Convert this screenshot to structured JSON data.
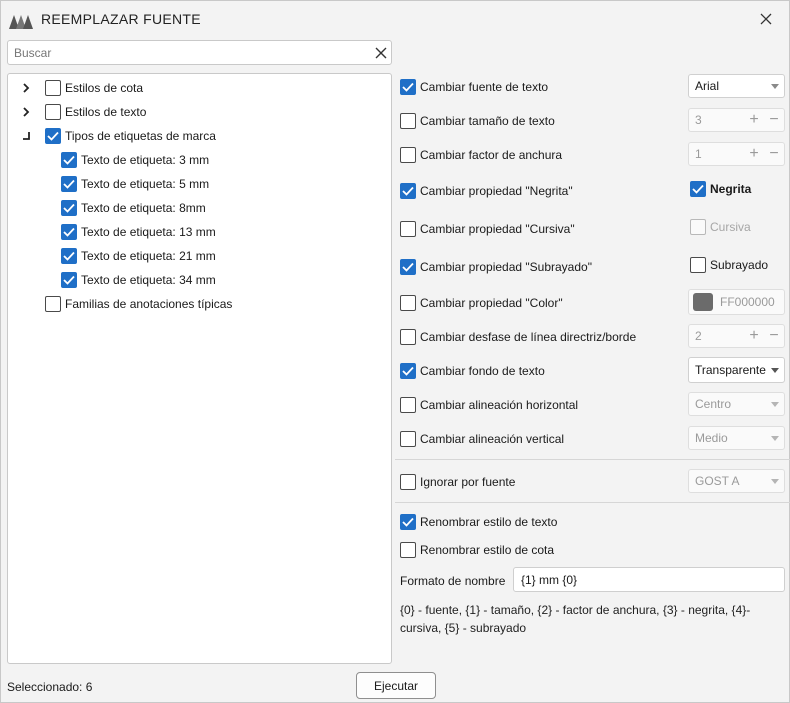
{
  "window": {
    "title": "REEMPLAZAR FUENTE",
    "logo_icon": "app-logo-icon",
    "close_icon": "close-icon"
  },
  "search": {
    "placeholder": "Buscar",
    "value": ""
  },
  "tree": [
    {
      "label": "Estilos de cota",
      "checked": false,
      "expander": "chevron-right",
      "level": 0
    },
    {
      "label": "Estilos de texto",
      "checked": false,
      "expander": "chevron-right",
      "level": 0
    },
    {
      "label": "Tipos de etiquetas de marca",
      "checked": true,
      "expander": "expanded",
      "level": 0
    },
    {
      "label": "Texto de etiqueta: 3 mm",
      "checked": true,
      "level": 1
    },
    {
      "label": "Texto de etiqueta: 5 mm",
      "checked": true,
      "level": 1
    },
    {
      "label": "Texto de etiqueta: 8mm",
      "checked": true,
      "level": 1
    },
    {
      "label": "Texto de etiqueta: 13 mm",
      "checked": true,
      "level": 1
    },
    {
      "label": "Texto de etiqueta: 21 mm",
      "checked": true,
      "level": 1
    },
    {
      "label": "Texto de etiqueta: 34 mm",
      "checked": true,
      "level": 1
    },
    {
      "label": "Familias de anotaciones típicas",
      "checked": false,
      "level": 0
    }
  ],
  "options": {
    "font": {
      "label": "Cambiar fuente de texto",
      "checked": true,
      "value": "Arial"
    },
    "size": {
      "label": "Cambiar tamaño de texto",
      "checked": false,
      "value": "3"
    },
    "width": {
      "label": "Cambiar factor de anchura",
      "checked": false,
      "value": "1"
    },
    "bold": {
      "label": "Cambiar propiedad \"Negrita\"",
      "checked": true,
      "side_label": "Negrita",
      "side_checked": true
    },
    "italic": {
      "label": "Cambiar propiedad \"Cursiva\"",
      "checked": false,
      "side_label": "Cursiva",
      "side_checked": false
    },
    "underline": {
      "label": "Cambiar propiedad \"Subrayado\"",
      "checked": true,
      "side_label": "Subrayado",
      "side_checked": false
    },
    "color": {
      "label": "Cambiar propiedad \"Color\"",
      "checked": false,
      "value": "FF000000",
      "swatch": "#6b6b6b"
    },
    "offset": {
      "label": "Cambiar desfase de línea directriz/borde",
      "checked": false,
      "value": "2"
    },
    "background": {
      "label": "Cambiar fondo de texto",
      "checked": true,
      "value": "Transparente"
    },
    "halign": {
      "label": "Cambiar alineación horizontal",
      "checked": false,
      "value": "Centro"
    },
    "valign": {
      "label": "Cambiar alineación vertical",
      "checked": false,
      "value": "Medio"
    },
    "ignore": {
      "label": "Ignorar por fuente",
      "checked": false,
      "value": "GOST A"
    },
    "rename_text": {
      "label": "Renombrar estilo de texto",
      "checked": true
    },
    "rename_dim": {
      "label": "Renombrar estilo de cota",
      "checked": false
    }
  },
  "name_format": {
    "label": "Formato de nombre",
    "value": "{1} mm {0}"
  },
  "hint": "{0} - fuente, {1} - tamaño, {2} - factor de anchura, {3} - negrita, {4}- cursiva, {5} - subrayado",
  "status": "Seleccionado: 6",
  "run_button": "Ejecutar",
  "colors": {
    "accent": "#1f6fc7",
    "border": "#c9c9c9",
    "background": "#f3f3f3"
  }
}
